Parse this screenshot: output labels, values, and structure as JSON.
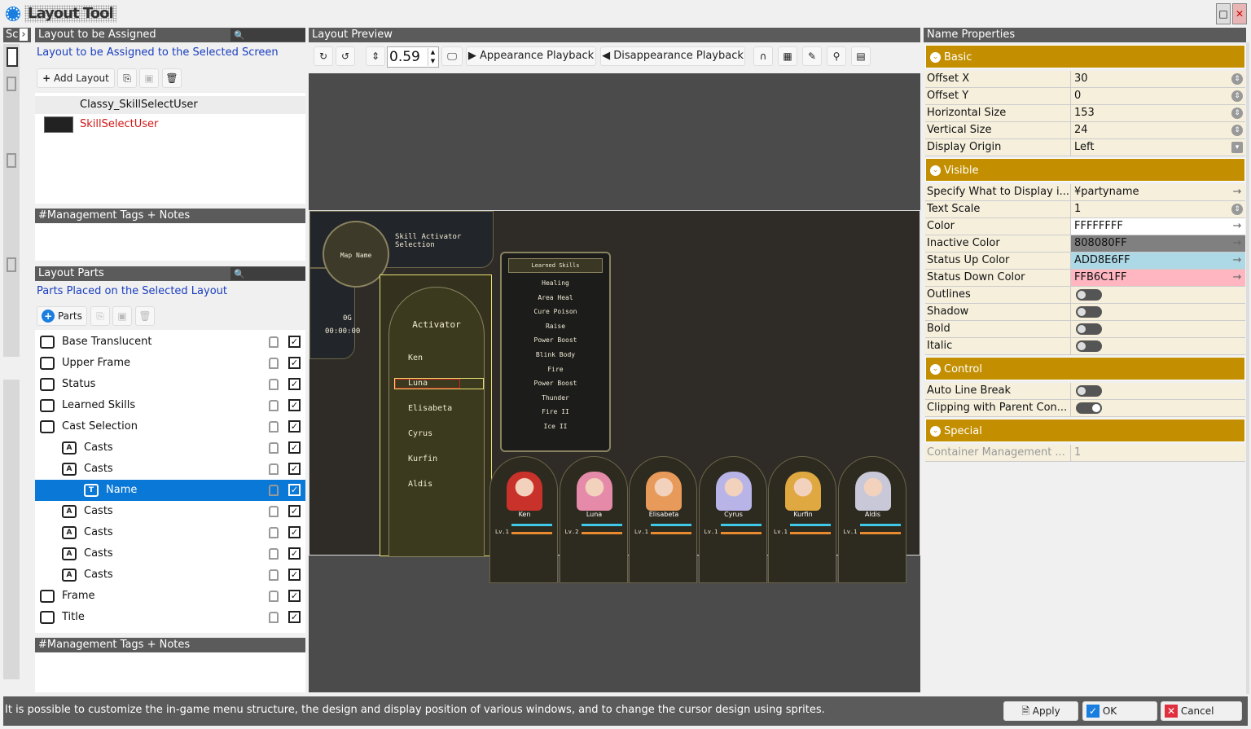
{
  "window": {
    "title": "Layout Tool",
    "side_tab": "Sc"
  },
  "assign": {
    "header": "Layout to be Assigned",
    "subtitle": "Layout to be Assigned to the Selected Screen",
    "add_label": "Add Layout",
    "items": [
      {
        "label": "Classy_SkillSelectUser"
      },
      {
        "label": "SkillSelectUser"
      }
    ],
    "tags_header": "#Management Tags + Notes"
  },
  "parts": {
    "header": "Layout Parts",
    "subtitle": "Parts Placed on the Selected Layout",
    "add_label": "Parts",
    "tags_header": "#Management Tags + Notes",
    "tree": [
      {
        "label": "Base Translucent",
        "level": 0,
        "icon": "folder"
      },
      {
        "label": "Upper Frame",
        "level": 0,
        "icon": "folder"
      },
      {
        "label": "Status",
        "level": 0,
        "icon": "folder"
      },
      {
        "label": "Learned Skills",
        "level": 0,
        "icon": "folder"
      },
      {
        "label": "Cast Selection",
        "level": 0,
        "icon": "folder-open"
      },
      {
        "label": "Casts",
        "level": 1,
        "icon": "cast"
      },
      {
        "label": "Casts",
        "level": 1,
        "icon": "cast-open"
      },
      {
        "label": "Name",
        "level": 2,
        "icon": "text",
        "selected": true
      },
      {
        "label": "Casts",
        "level": 1,
        "icon": "cast"
      },
      {
        "label": "Casts",
        "level": 1,
        "icon": "cast"
      },
      {
        "label": "Casts",
        "level": 1,
        "icon": "cast"
      },
      {
        "label": "Casts",
        "level": 1,
        "icon": "cast"
      },
      {
        "label": "Frame",
        "level": 0,
        "icon": "folder"
      },
      {
        "label": "Title",
        "level": 0,
        "icon": "folder"
      }
    ]
  },
  "preview": {
    "header": "Layout Preview",
    "zoom": "0.59",
    "appear_label": "Appearance Playback",
    "disappear_label": "Disappearance Playback",
    "game": {
      "title": "Skill Activator Selection",
      "map_name": "Map Name",
      "gold": "0G",
      "time": "00:00:00",
      "activator": "Activator",
      "cursor_name": "Luna",
      "members": [
        "Ken",
        "Luna",
        "Elisabeta",
        "Cyrus",
        "Kurfin",
        "Aldis"
      ],
      "skills_title": "Learned Skills",
      "skills": [
        "Healing",
        "Area Heal",
        "Cure Poison",
        "Raise",
        "Power Boost",
        "Blink Body",
        "Fire",
        "Power Boost",
        "Thunder",
        "Fire II",
        "Ice II"
      ],
      "cards": [
        {
          "name": "Ken",
          "lv": "Lv.1",
          "hair": "#c8322a"
        },
        {
          "name": "Luna",
          "lv": "Lv.2",
          "hair": "#e58aa8"
        },
        {
          "name": "Elisabeta",
          "lv": "Lv.1",
          "hair": "#e89a5a"
        },
        {
          "name": "Cyrus",
          "lv": "Lv.1",
          "hair": "#b8b4e8"
        },
        {
          "name": "Kurfin",
          "lv": "Lv.1",
          "hair": "#e0a840"
        },
        {
          "name": "Aldis",
          "lv": "Lv.1",
          "hair": "#c8c8d8"
        }
      ]
    }
  },
  "props": {
    "header": "Name Properties",
    "sections": [
      {
        "title": "Basic",
        "rows": [
          {
            "k": "Offset X",
            "v": "30",
            "ctl": "spin"
          },
          {
            "k": "Offset Y",
            "v": "0",
            "ctl": "spin"
          },
          {
            "k": "Horizontal Size",
            "v": "153",
            "ctl": "spin"
          },
          {
            "k": "Vertical Size",
            "v": "24",
            "ctl": "spin"
          },
          {
            "k": "Display Origin",
            "v": "Left",
            "ctl": "drop"
          }
        ]
      },
      {
        "title": "Visible",
        "rows": [
          {
            "k": "Specify What to Display i...",
            "v": "¥partyname",
            "ctl": "arrow"
          },
          {
            "k": "Text Scale",
            "v": "1",
            "ctl": "spin"
          },
          {
            "k": "Color",
            "v": "FFFFFFFF",
            "ctl": "arrow",
            "bg": "#ffffff"
          },
          {
            "k": "Inactive Color",
            "v": "808080FF",
            "ctl": "arrow",
            "bg": "#808080"
          },
          {
            "k": "Status Up Color",
            "v": "ADD8E6FF",
            "ctl": "arrow",
            "bg": "#add8e6"
          },
          {
            "k": "Status Down Color",
            "v": "FFB6C1FF",
            "ctl": "arrow",
            "bg": "#ffb6c1"
          },
          {
            "k": "Outlines",
            "toggle": false
          },
          {
            "k": "Shadow",
            "toggle": false
          },
          {
            "k": "Bold",
            "toggle": false
          },
          {
            "k": "Italic",
            "toggle": false
          }
        ]
      },
      {
        "title": "Control",
        "rows": [
          {
            "k": "Auto Line Break",
            "toggle": false
          },
          {
            "k": "Clipping with Parent Con...",
            "toggle": true
          }
        ]
      },
      {
        "title": "Special",
        "rows": [
          {
            "k": "Container Management ...",
            "v": "1",
            "disabled": true
          }
        ]
      }
    ]
  },
  "status": {
    "text": "It is possible to customize the in-game menu structure, the design and display position of various windows, and to change the cursor design using sprites.",
    "apply": "Apply",
    "ok": "OK",
    "cancel": "Cancel"
  }
}
